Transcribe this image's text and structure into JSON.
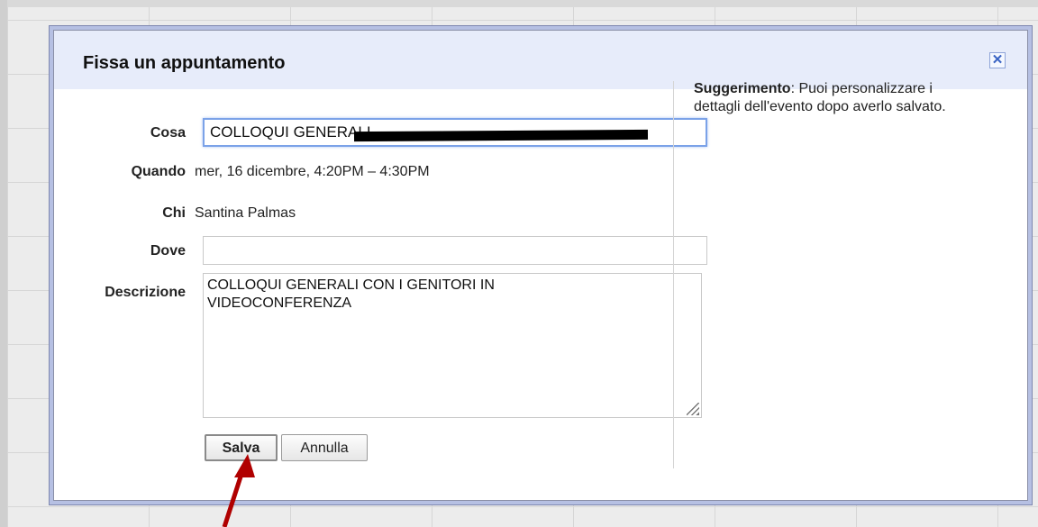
{
  "dialog": {
    "title": "Fissa un appuntamento",
    "close_symbol": "✕"
  },
  "form": {
    "cosa_label": "Cosa",
    "cosa_value": "COLLOQUI GENERALI-",
    "quando_label": "Quando",
    "quando_value": "mer, 16 dicembre, 4:20PM – 4:30PM",
    "chi_label": "Chi",
    "chi_value": "Santina Palmas",
    "dove_label": "Dove",
    "dove_value": "",
    "descrizione_label": "Descrizione",
    "descrizione_value": "COLLOQUI GENERALI CON I GENITORI IN\nVIDEOCONFERENZA"
  },
  "buttons": {
    "save_label": "Salva",
    "cancel_label": "Annulla"
  },
  "hint": {
    "bold": "Suggerimento",
    "text": ": Puoi personalizzare i dettagli dell'evento dopo averlo salvato."
  },
  "colors": {
    "header_bg": "#e7ecfa",
    "arrow": "#b00000",
    "focus_border": "#7ba2e8"
  },
  "icons": {
    "close": "close-icon",
    "arrow": "red-arrow-annotation",
    "grip": "resize-grip-icon"
  }
}
